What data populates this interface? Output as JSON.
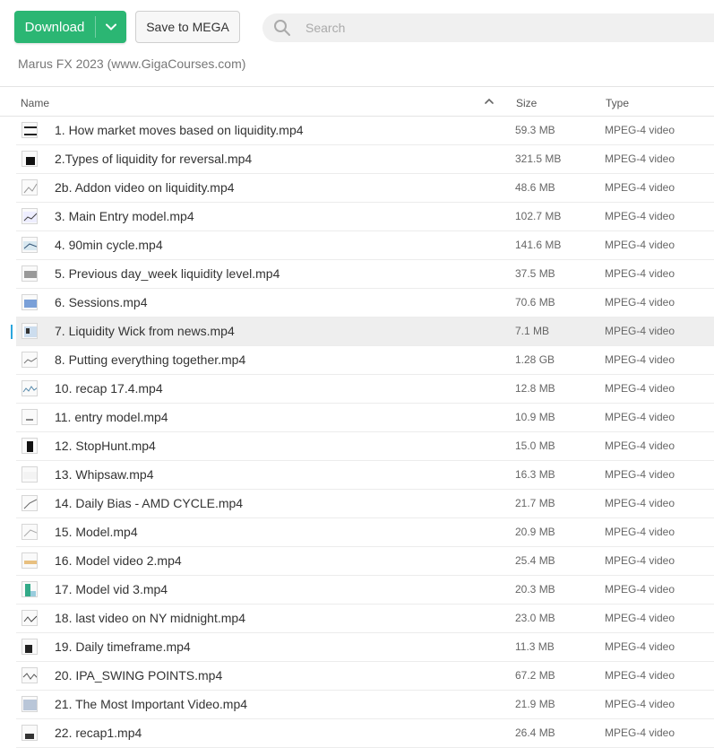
{
  "toolbar": {
    "download_label": "Download",
    "save_label": "Save to MEGA",
    "search_placeholder": "Search"
  },
  "breadcrumb": "Marus FX 2023 (www.GigaCourses.com)",
  "columns": {
    "name": "Name",
    "size": "Size",
    "type": "Type"
  },
  "colors": {
    "accent": "#2bb673",
    "selected_marker": "#2ba6de"
  },
  "files": [
    {
      "name": "1. How market moves based on liquidity.mp4",
      "size": "59.3 MB",
      "type": "MPEG-4 video"
    },
    {
      "name": "2.Types of liquidity for reversal.mp4",
      "size": "321.5 MB",
      "type": "MPEG-4 video"
    },
    {
      "name": "2b. Addon video on liquidity.mp4",
      "size": "48.6 MB",
      "type": "MPEG-4 video"
    },
    {
      "name": "3. Main Entry model.mp4",
      "size": "102.7 MB",
      "type": "MPEG-4 video"
    },
    {
      "name": "4. 90min cycle.mp4",
      "size": "141.6 MB",
      "type": "MPEG-4 video"
    },
    {
      "name": "5. Previous day_week liquidity level.mp4",
      "size": "37.5 MB",
      "type": "MPEG-4 video"
    },
    {
      "name": "6. Sessions.mp4",
      "size": "70.6 MB",
      "type": "MPEG-4 video"
    },
    {
      "name": "7. Liquidity Wick from news.mp4",
      "size": "7.1 MB",
      "type": "MPEG-4 video",
      "selected": true
    },
    {
      "name": "8. Putting everything together.mp4",
      "size": "1.28 GB",
      "type": "MPEG-4 video"
    },
    {
      "name": "10. recap 17.4.mp4",
      "size": "12.8 MB",
      "type": "MPEG-4 video"
    },
    {
      "name": "11. entry model.mp4",
      "size": "10.9 MB",
      "type": "MPEG-4 video"
    },
    {
      "name": "12. StopHunt.mp4",
      "size": "15.0 MB",
      "type": "MPEG-4 video"
    },
    {
      "name": "13. Whipsaw.mp4",
      "size": "16.3 MB",
      "type": "MPEG-4 video"
    },
    {
      "name": "14. Daily Bias - AMD CYCLE.mp4",
      "size": "21.7 MB",
      "type": "MPEG-4 video"
    },
    {
      "name": "15. Model.mp4",
      "size": "20.9 MB",
      "type": "MPEG-4 video"
    },
    {
      "name": "16. Model video 2.mp4",
      "size": "25.4 MB",
      "type": "MPEG-4 video"
    },
    {
      "name": "17. Model vid 3.mp4",
      "size": "20.3 MB",
      "type": "MPEG-4 video"
    },
    {
      "name": "18. last video on NY midnight.mp4",
      "size": "23.0 MB",
      "type": "MPEG-4 video"
    },
    {
      "name": "19. Daily timeframe.mp4",
      "size": "11.3 MB",
      "type": "MPEG-4 video"
    },
    {
      "name": "20. IPA_SWING POINTS.mp4",
      "size": "67.2 MB",
      "type": "MPEG-4 video"
    },
    {
      "name": "21. The Most Important Video.mp4",
      "size": "21.9 MB",
      "type": "MPEG-4 video"
    },
    {
      "name": "22. recap1.mp4",
      "size": "26.4 MB",
      "type": "MPEG-4 video"
    }
  ]
}
